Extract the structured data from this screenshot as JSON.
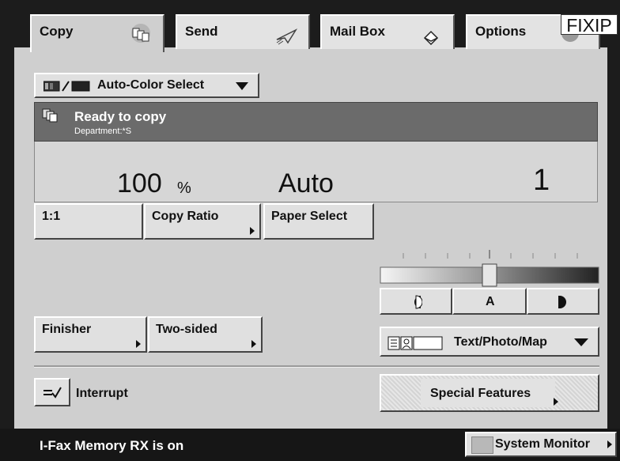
{
  "tabs": [
    {
      "label": "Copy",
      "icon": "copy-pages-icon"
    },
    {
      "label": "Send",
      "icon": "paper-plane-icon"
    },
    {
      "label": "Mail Box",
      "icon": "mailbox-tray-icon"
    },
    {
      "label": "Options",
      "icon": "options-dial-icon"
    }
  ],
  "brand": "FIXIP",
  "color_select": {
    "label": "Auto-Color Select"
  },
  "status": {
    "title": "Ready to copy",
    "department": "Department:*S"
  },
  "readout": {
    "ratio_value": "100",
    "ratio_unit": "%",
    "paper": "Auto",
    "copies": "1"
  },
  "buttons": {
    "one_to_one": "1:1",
    "copy_ratio": "Copy Ratio",
    "paper_select": "Paper Select",
    "finisher": "Finisher",
    "two_sided": "Two-sided",
    "interrupt": "Interrupt",
    "special_features": "Special Features"
  },
  "density": {
    "auto_label": "A",
    "level": 0.5
  },
  "original_type": {
    "label": "Text/Photo/Map"
  },
  "footer": {
    "message": "I-Fax Memory RX is on",
    "system_monitor": "System Monitor"
  },
  "colors": {
    "panel": "#cfcfcf",
    "status_bar": "#6b6b6b",
    "background": "#1c1c1c"
  }
}
